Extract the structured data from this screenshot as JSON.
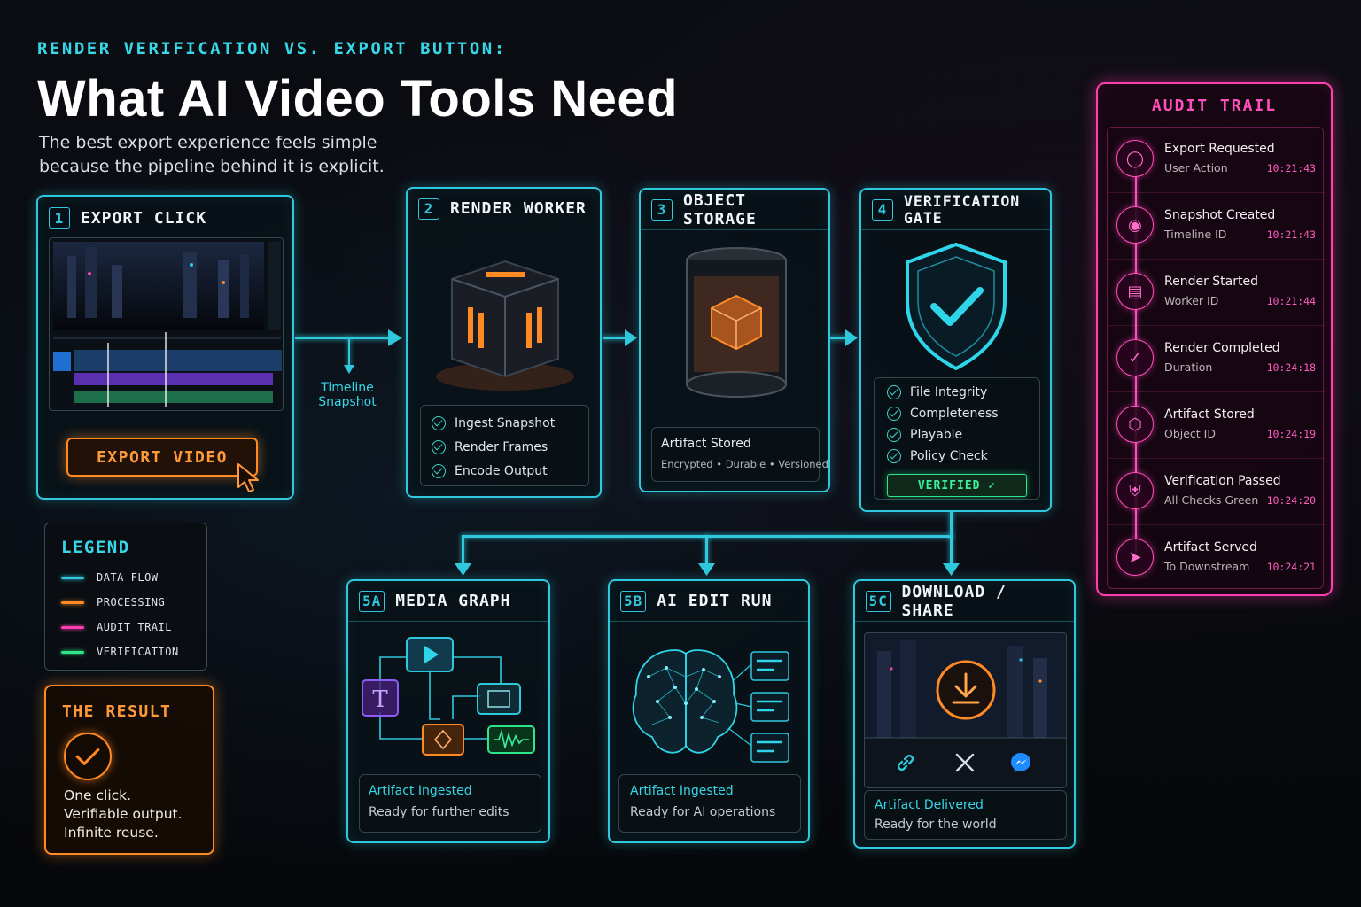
{
  "header": {
    "kicker": "RENDER VERIFICATION VS. EXPORT BUTTON:",
    "title": "What AI Video Tools Need",
    "subtitle": "The best export experience feels simple because the pipeline behind it is explicit."
  },
  "step1": {
    "num": "1",
    "title": "EXPORT CLICK",
    "button": "EXPORT VIDEO"
  },
  "flow_label": "Timeline Snapshot",
  "step2": {
    "num": "2",
    "title": "RENDER WORKER",
    "checks": [
      "Ingest Snapshot",
      "Render Frames",
      "Encode Output"
    ]
  },
  "step3": {
    "num": "3",
    "title": "OBJECT STORAGE",
    "status": "Artifact Stored",
    "detail": "Encrypted • Durable • Versioned"
  },
  "step4": {
    "num": "4",
    "title": "VERIFICATION GATE",
    "checks": [
      "File Integrity",
      "Completeness",
      "Playable",
      "Policy Check"
    ],
    "verified": "VERIFIED ✓"
  },
  "step5a": {
    "num": "5A",
    "title": "MEDIA GRAPH",
    "status": "Artifact Ingested",
    "detail": "Ready for further edits"
  },
  "step5b": {
    "num": "5B",
    "title": "AI EDIT RUN",
    "status": "Artifact Ingested",
    "detail": "Ready for AI operations"
  },
  "step5c": {
    "num": "5C",
    "title": "DOWNLOAD / SHARE",
    "status": "Artifact Delivered",
    "detail": "Ready for the world"
  },
  "legend": {
    "title": "LEGEND",
    "items": [
      {
        "label": "DATA FLOW",
        "color": "#2fc8dd"
      },
      {
        "label": "PROCESSING",
        "color": "#ff8a24"
      },
      {
        "label": "AUDIT TRAIL",
        "color": "#ff3fb0"
      },
      {
        "label": "VERIFICATION",
        "color": "#2ee58a"
      }
    ]
  },
  "result": {
    "title": "THE RESULT",
    "lines": [
      "One click.",
      "Verifiable output.",
      "Infinite reuse."
    ]
  },
  "audit": {
    "title": "AUDIT TRAIL",
    "items": [
      {
        "label": "Export Requested",
        "sub": "User Action",
        "time": "10:21:43",
        "icon": "user-icon"
      },
      {
        "label": "Snapshot Created",
        "sub": "Timeline ID",
        "time": "10:21:43",
        "icon": "camera-icon"
      },
      {
        "label": "Render Started",
        "sub": "Worker ID",
        "time": "10:21:44",
        "icon": "server-icon"
      },
      {
        "label": "Render Completed",
        "sub": "Duration",
        "time": "10:24:18",
        "icon": "check-circle-icon"
      },
      {
        "label": "Artifact Stored",
        "sub": "Object ID",
        "time": "10:24:19",
        "icon": "cube-icon"
      },
      {
        "label": "Verification Passed",
        "sub": "All Checks Green",
        "time": "10:24:20",
        "icon": "shield-check-icon"
      },
      {
        "label": "Artifact Served",
        "sub": "To Downstream",
        "time": "10:24:21",
        "icon": "send-icon"
      }
    ]
  },
  "colors": {
    "accent": "#2fc8dd",
    "processing": "#ff8a24",
    "audit": "#ff3fb0",
    "verify": "#2ee58a"
  }
}
